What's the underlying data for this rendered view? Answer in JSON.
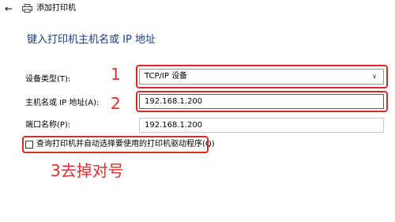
{
  "window": {
    "title": "添加打印机",
    "back_icon": "back-arrow-icon",
    "printer_icon": "printer-icon"
  },
  "heading": "键入打印机主机名或 IP 地址",
  "form": {
    "device_type": {
      "label": "设备类型(T):",
      "value": "TCP/IP 设备"
    },
    "hostname": {
      "label": "主机名或 IP 地址(A):",
      "value": "192.168.1.200"
    },
    "port": {
      "label": "端口名称(P):",
      "value": "192.168.1.200"
    },
    "query_driver": {
      "label": "查询打印机并自动选择要使用的打印机驱动程序(Q)",
      "checked": false
    }
  },
  "annotations": {
    "num1": "1",
    "num2": "2",
    "note3": "3去掉对号",
    "color": "#e0302f"
  }
}
